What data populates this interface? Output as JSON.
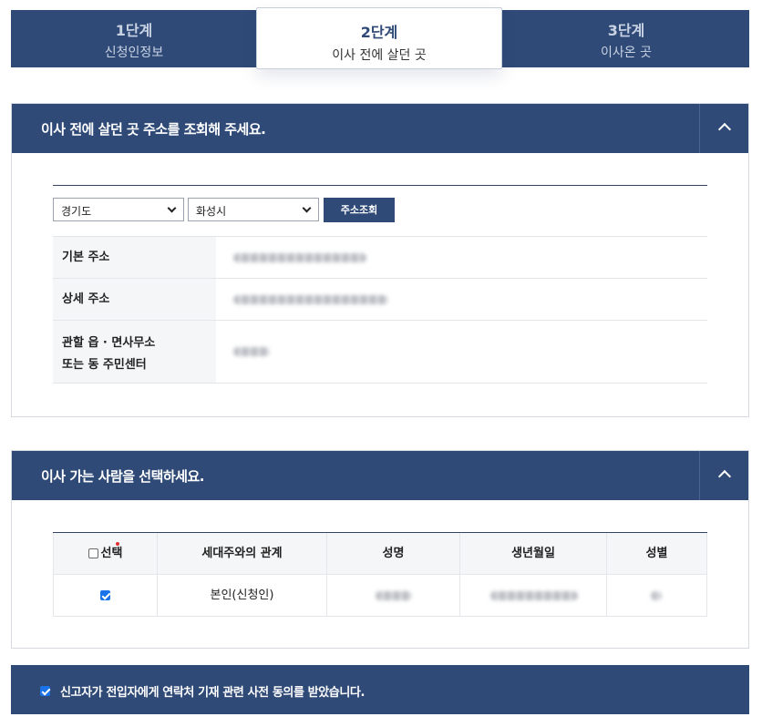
{
  "steps": [
    {
      "num": "1단계",
      "name": "신청인정보"
    },
    {
      "num": "2단계",
      "name": "이사 전에 살던 곳"
    },
    {
      "num": "3단계",
      "name": "이사온 곳"
    }
  ],
  "section_prev": {
    "title": "이사 전에 살던 곳 주소를 조회해 주세요.",
    "province": "경기도",
    "city": "화성시",
    "search_button": "주소조회",
    "rows": [
      {
        "label": "기본 주소"
      },
      {
        "label": "상세 주소"
      },
      {
        "label_line1": "관할 읍 · 면사무소",
        "label_line2": "또는 동 주민센터"
      }
    ]
  },
  "section_people": {
    "title": "이사 가는 사람을 선택하세요.",
    "columns": [
      "선택",
      "세대주와의 관계",
      "성명",
      "생년월일",
      "성별"
    ],
    "rows": [
      {
        "selected": true,
        "relation": "본인(신청인)"
      }
    ]
  },
  "consent": {
    "checked": true,
    "text": "신고자가 전입자에게 연락처 기재 관련 사전 동의를 받았습니다."
  },
  "colors": {
    "primary": "#2f4a77",
    "checkbox": "#1a73e8",
    "required_dot": "#e03030"
  }
}
